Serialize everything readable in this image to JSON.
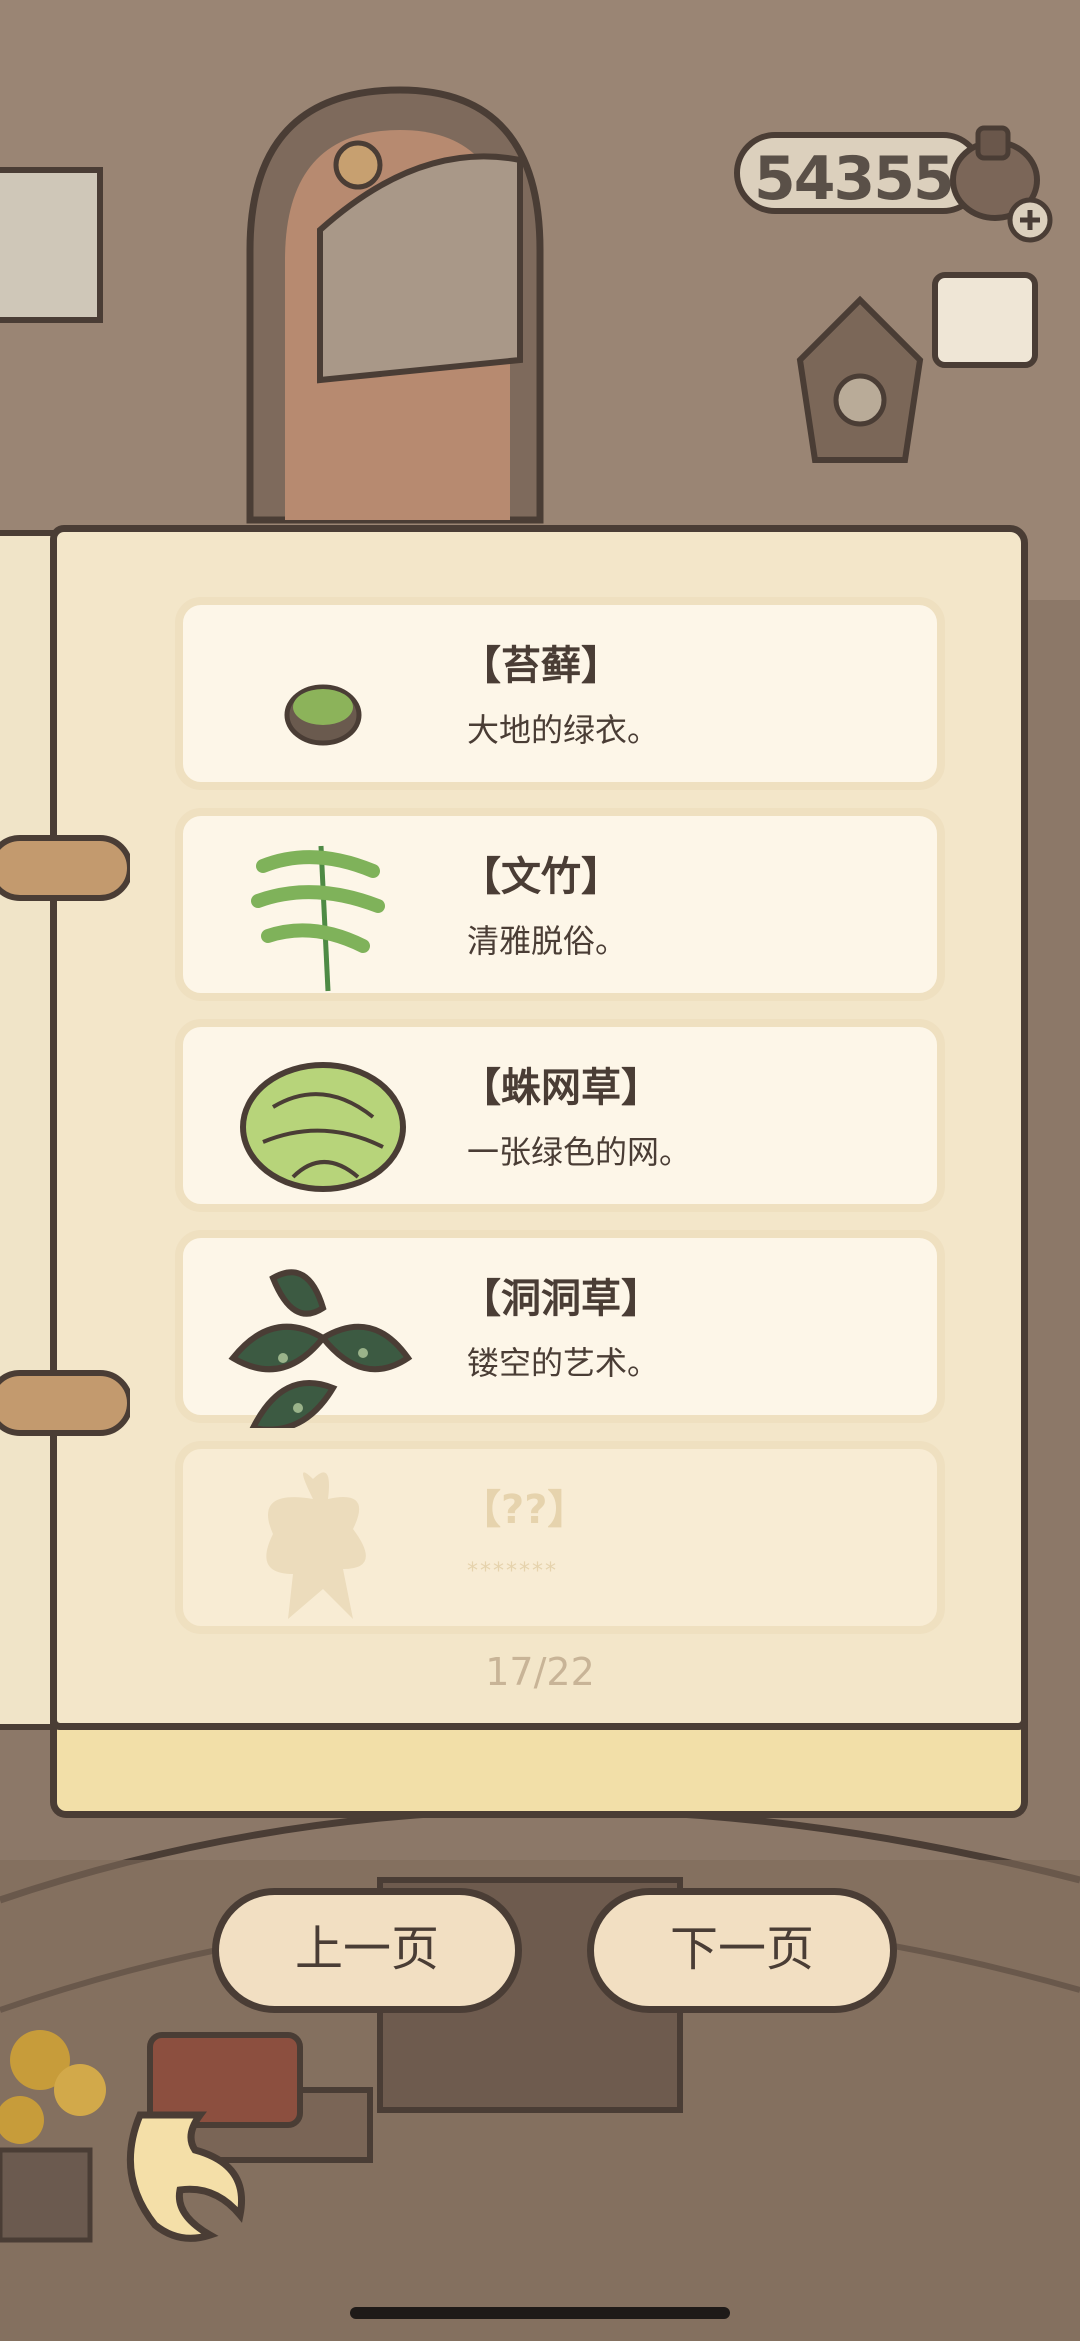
{
  "currency": {
    "amount": "543559"
  },
  "catalog": {
    "entries": [
      {
        "title": "【苔藓】",
        "description": "大地的绿衣。",
        "icon": "moss-icon",
        "locked": false
      },
      {
        "title": "【文竹】",
        "description": "清雅脱俗。",
        "icon": "asparagus-fern-icon",
        "locked": false
      },
      {
        "title": "【蛛网草】",
        "description": "一张绿色的网。",
        "icon": "spider-plant-icon",
        "locked": false
      },
      {
        "title": "【洞洞草】",
        "description": "镂空的艺术。",
        "icon": "monstera-icon",
        "locked": false
      },
      {
        "title": "【??】",
        "description": "*******",
        "icon": "unknown-plant-icon",
        "locked": true
      }
    ],
    "page_indicator": "17/22"
  },
  "nav": {
    "prev_label": "上一页",
    "next_label": "下一页"
  },
  "colors": {
    "outline": "#4a3d35",
    "page": "#f3e6c9",
    "card": "#fdf6e8",
    "background": "#8a7766"
  }
}
